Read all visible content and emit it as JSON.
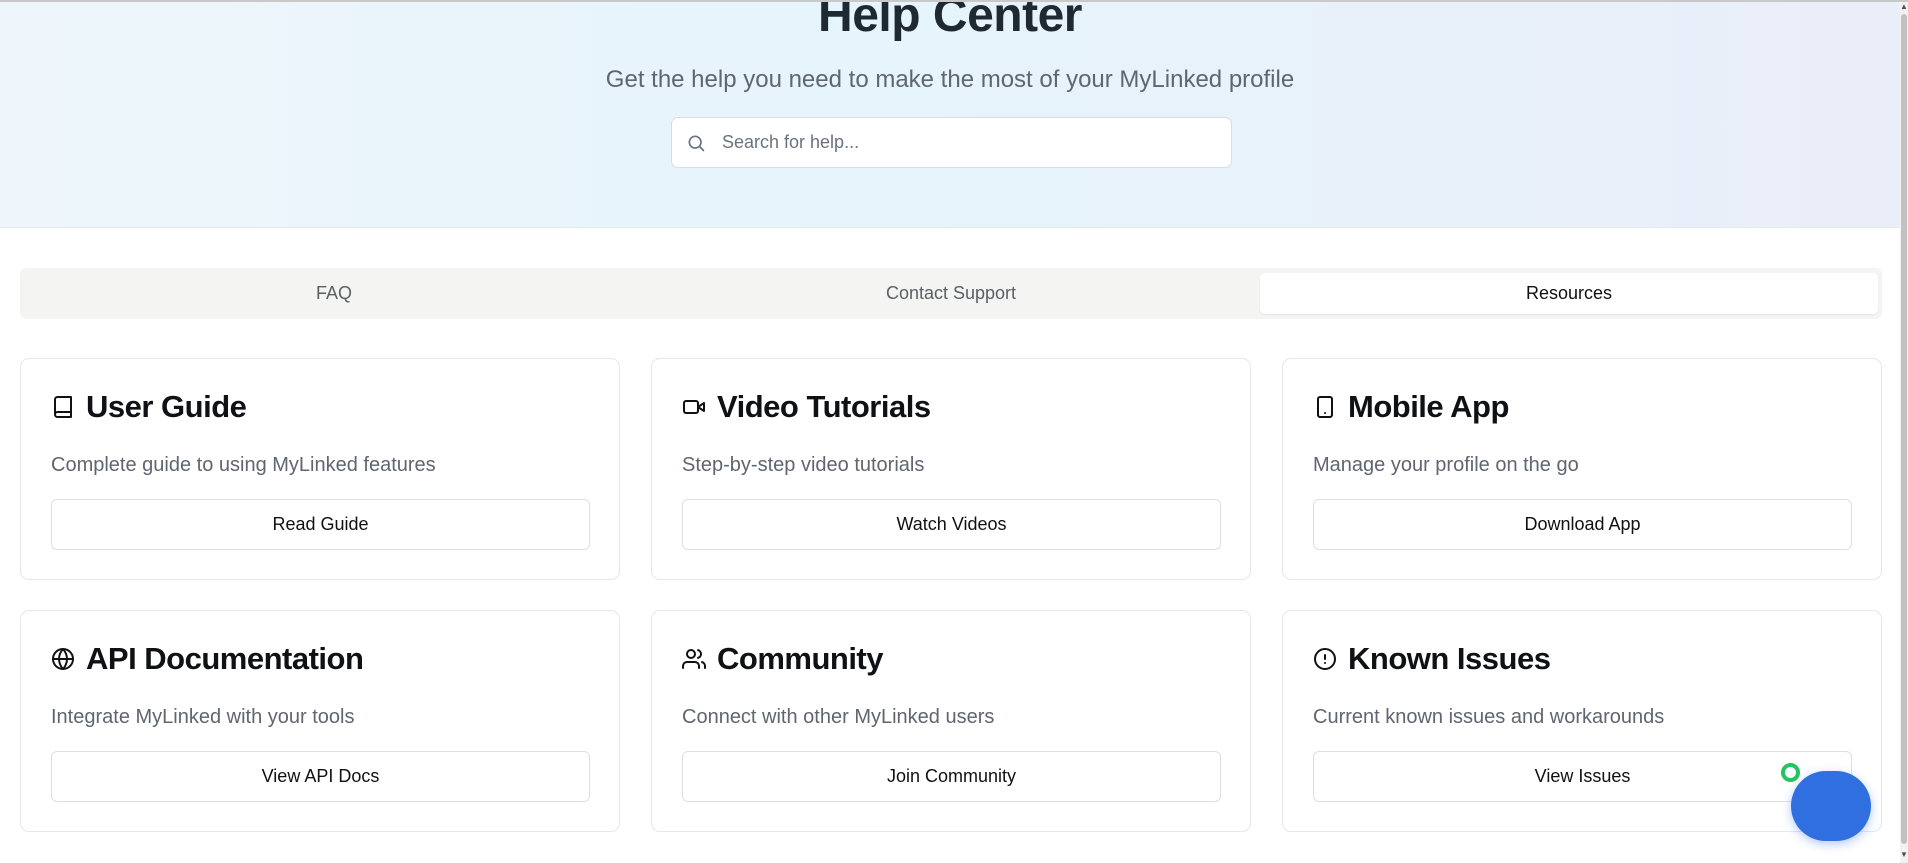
{
  "hero": {
    "title": "Help Center",
    "subtitle": "Get the help you need to make the most of your MyLinked profile",
    "search": {
      "placeholder": "Search for help...",
      "value": "",
      "icon": "search-icon"
    }
  },
  "tabs": [
    {
      "label": "FAQ",
      "active": false
    },
    {
      "label": "Contact Support",
      "active": false
    },
    {
      "label": "Resources",
      "active": true
    }
  ],
  "resources": [
    {
      "icon": "book-icon",
      "title": "User Guide",
      "description": "Complete guide to using MyLinked features",
      "button": "Read Guide"
    },
    {
      "icon": "video-icon",
      "title": "Video Tutorials",
      "description": "Step-by-step video tutorials",
      "button": "Watch Videos"
    },
    {
      "icon": "smartphone-icon",
      "title": "Mobile App",
      "description": "Manage your profile on the go",
      "button": "Download App"
    },
    {
      "icon": "globe-icon",
      "title": "API Documentation",
      "description": "Integrate MyLinked with your tools",
      "button": "View API Docs"
    },
    {
      "icon": "users-icon",
      "title": "Community",
      "description": "Connect with other MyLinked users",
      "button": "Join Community"
    },
    {
      "icon": "alert-circle-icon",
      "title": "Known Issues",
      "description": "Current known issues and workarounds",
      "button": "View Issues"
    }
  ],
  "colors": {
    "accent": "#2f6fe0",
    "online": "#22c55e",
    "muted_text": "#5f6670",
    "border": "#e5e7eb"
  }
}
